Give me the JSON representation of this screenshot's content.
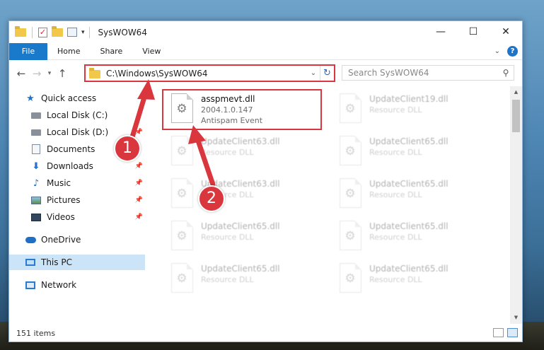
{
  "window": {
    "title": "SysWOW64",
    "buttons": {
      "minimize": "—",
      "maximize": "☐",
      "close": "✕"
    }
  },
  "ribbon": {
    "tabs": [
      "File",
      "Home",
      "Share",
      "View"
    ],
    "help": "?"
  },
  "navigation": {
    "address": "C:\\Windows\\SysWOW64",
    "search_placeholder": "Search SysWOW64"
  },
  "sidebar": {
    "items": [
      {
        "label": "Quick access",
        "icon": "star-icon"
      },
      {
        "label": "Local Disk (C:)",
        "icon": "drive-icon"
      },
      {
        "label": "Local Disk (D:)",
        "icon": "drive-icon"
      },
      {
        "label": "Documents",
        "icon": "documents-icon"
      },
      {
        "label": "Downloads",
        "icon": "download-icon"
      },
      {
        "label": "Music",
        "icon": "music-icon"
      },
      {
        "label": "Pictures",
        "icon": "pictures-icon"
      },
      {
        "label": "Videos",
        "icon": "videos-icon"
      },
      {
        "label": "OneDrive",
        "icon": "onedrive-icon"
      },
      {
        "label": "This PC",
        "icon": "pc-icon",
        "selected": true
      },
      {
        "label": "Network",
        "icon": "network-icon"
      }
    ]
  },
  "files": [
    {
      "name": "asspmevt.dll",
      "line1": "2004.1.0.147",
      "line2": "Antispam Event",
      "highlighted": true
    },
    {
      "name": "UpdateClient19.dll",
      "line1": "Resource DLL"
    },
    {
      "name": "UpdateClient63.dll",
      "line1": "Resource DLL"
    },
    {
      "name": "UpdateClient65.dll",
      "line1": "Resource DLL"
    },
    {
      "name": "UpdateClient63.dll",
      "line1": "Resource DLL"
    },
    {
      "name": "UpdateClient65.dll",
      "line1": "Resource DLL"
    },
    {
      "name": "UpdateClient65.dll",
      "line1": "Resource DLL"
    },
    {
      "name": "UpdateClient65.dll",
      "line1": "Resource DLL"
    },
    {
      "name": "UpdateClient65.dll",
      "line1": "Resource DLL"
    },
    {
      "name": "UpdateClient65.dll",
      "line1": "Resource DLL"
    }
  ],
  "status": {
    "item_count": "151 items"
  },
  "callouts": {
    "one": "1",
    "two": "2"
  },
  "colors": {
    "accent": "#1979ca",
    "highlight": "#d9363e",
    "selected": "#cce4f7"
  }
}
